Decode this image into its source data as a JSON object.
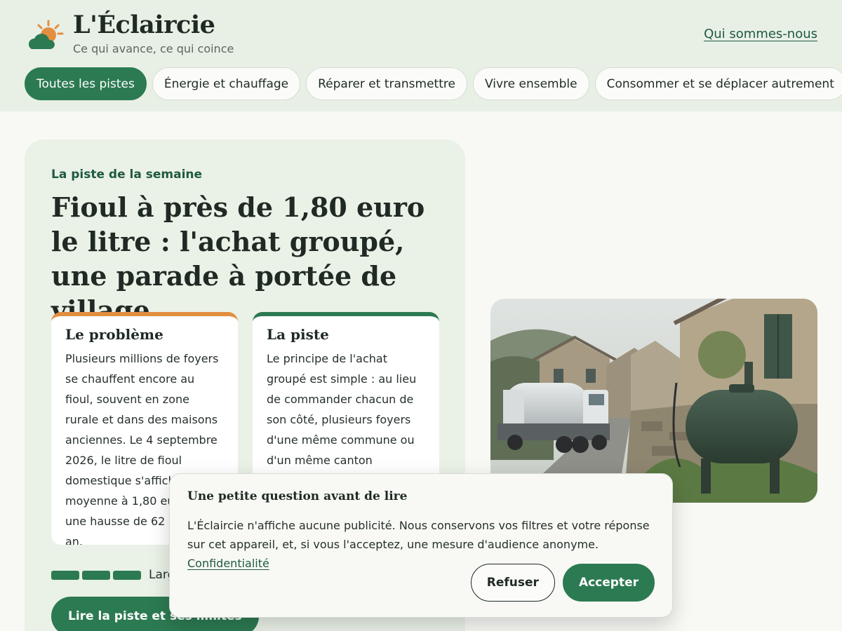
{
  "brand": {
    "title": "L'Éclaircie",
    "tagline": "Ce qui avance, ce qui coince",
    "logo_icon": "sun-cloud-icon"
  },
  "nav": {
    "about_label": "Qui sommes-nous"
  },
  "filters": [
    {
      "label": "Toutes les pistes",
      "active": true
    },
    {
      "label": "Énergie et chauffage",
      "active": false
    },
    {
      "label": "Réparer et transmettre",
      "active": false
    },
    {
      "label": "Vivre ensemble",
      "active": false
    },
    {
      "label": "Consommer et se déplacer autrement",
      "active": false
    }
  ],
  "feature": {
    "eyebrow": "La piste de la semaine",
    "headline": "Fioul à près de 1,80 euro le litre : l'achat groupé, une parade à portée de village",
    "problem": {
      "title": "Le problème",
      "text": "Plusieurs millions de foyers se chauffent encore au fioul, souvent en zone rurale et dans des maisons anciennes. Le 4 septembre 2026, le litre de fioul domestique s'affichait en moyenne à 1,80 euro, soit une hausse de 62 % sur un an."
    },
    "solution": {
      "title": "La piste",
      "text": "Le principe de l'achat groupé est simple : au lieu de commander chacun de son côté, plusieurs foyers d'une même commune ou d'un même canton rassemblent"
    },
    "progress_label": "Larg",
    "progress_segments": 3,
    "cta_label": "Lire la piste et ses limites"
  },
  "photo": {
    "description_icon": "fuel-truck-village-photo"
  },
  "consent": {
    "title": "Une petite question avant de lire",
    "text": "L'Éclaircie n'affiche aucune publicité. Nous conservons vos filtres et votre réponse sur cet appareil, et, si vous l'acceptez, une mesure d'audience anonyme.",
    "privacy_link": "Confidentialité",
    "refuse_label": "Refuser",
    "accept_label": "Accepter"
  },
  "colors": {
    "accent": "#2c7a52",
    "header_bg": "#e8f0e6",
    "problem_accent": "#e28e3f"
  }
}
